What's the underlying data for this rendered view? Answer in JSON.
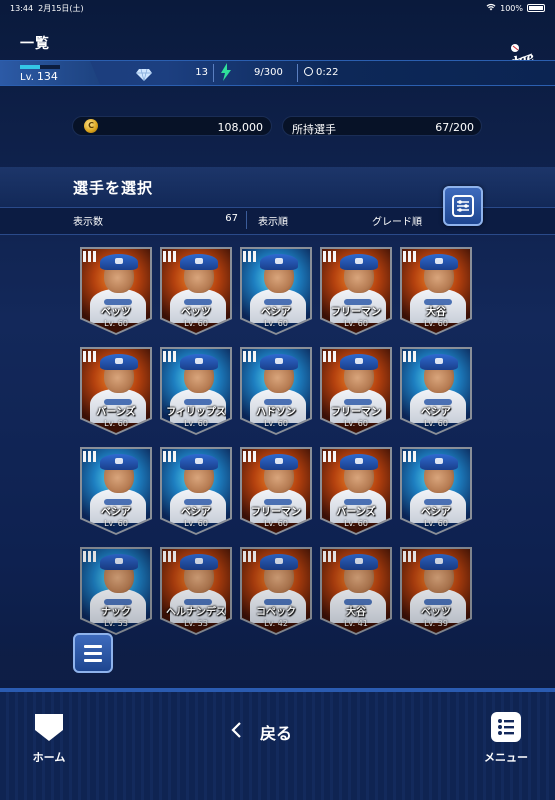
{
  "status_bar": {
    "time": "13:44",
    "date": "2月15日(土)",
    "battery": "100%"
  },
  "header": {
    "title": "一覧",
    "level_label": "Lv.",
    "level": "134",
    "gems": "13",
    "stamina": "9/300",
    "timer": "0:22",
    "team_logo_text": "Dodgers"
  },
  "currency": {
    "coins": "108,000",
    "owned_label": "所持選手",
    "owned_value": "67/200"
  },
  "select_panel": {
    "title": "選手を選択",
    "count_label": "表示数",
    "count": "67",
    "order_label": "表示順",
    "order_value": "グレード順"
  },
  "players": [
    {
      "name": "ベッツ",
      "level": "Lv. 60",
      "bg": "fire"
    },
    {
      "name": "ベッツ",
      "level": "Lv. 60",
      "bg": "fire"
    },
    {
      "name": "ベシア",
      "level": "Lv. 60",
      "bg": "ice"
    },
    {
      "name": "フリーマン",
      "level": "Lv. 60",
      "bg": "fire"
    },
    {
      "name": "大谷",
      "level": "Lv. 60",
      "bg": "fire"
    },
    {
      "name": "バーンズ",
      "level": "Lv. 60",
      "bg": "fire"
    },
    {
      "name": "フィリップス",
      "level": "Lv. 60",
      "bg": "ice"
    },
    {
      "name": "ハドソン",
      "level": "Lv. 60",
      "bg": "ice"
    },
    {
      "name": "フリーマン",
      "level": "Lv. 60",
      "bg": "fire"
    },
    {
      "name": "ベシア",
      "level": "Lv. 60",
      "bg": "ice"
    },
    {
      "name": "ベシア",
      "level": "Lv. 60",
      "bg": "ice"
    },
    {
      "name": "ベシア",
      "level": "Lv. 60",
      "bg": "ice"
    },
    {
      "name": "フリーマン",
      "level": "Lv. 60",
      "bg": "fire"
    },
    {
      "name": "バーンズ",
      "level": "Lv. 60",
      "bg": "fire"
    },
    {
      "name": "ベシア",
      "level": "Lv. 60",
      "bg": "ice"
    },
    {
      "name": "ナック",
      "level": "Lv. 53",
      "bg": "ice"
    },
    {
      "name": "ヘルナンデス",
      "level": "Lv. 53",
      "bg": "fire"
    },
    {
      "name": "コペック",
      "level": "Lv. 42",
      "bg": "fire"
    },
    {
      "name": "大谷",
      "level": "Lv. 41",
      "bg": "fire"
    },
    {
      "name": "ベッツ",
      "level": "Lv. 39",
      "bg": "fire"
    }
  ],
  "bottom_nav": {
    "home_label": "ホーム",
    "back_label": "戻る",
    "menu_label": "メニュー"
  },
  "colors": {
    "accent": "#2a5bb0",
    "level_bar": "#34c6e6",
    "background": "#13285a"
  }
}
